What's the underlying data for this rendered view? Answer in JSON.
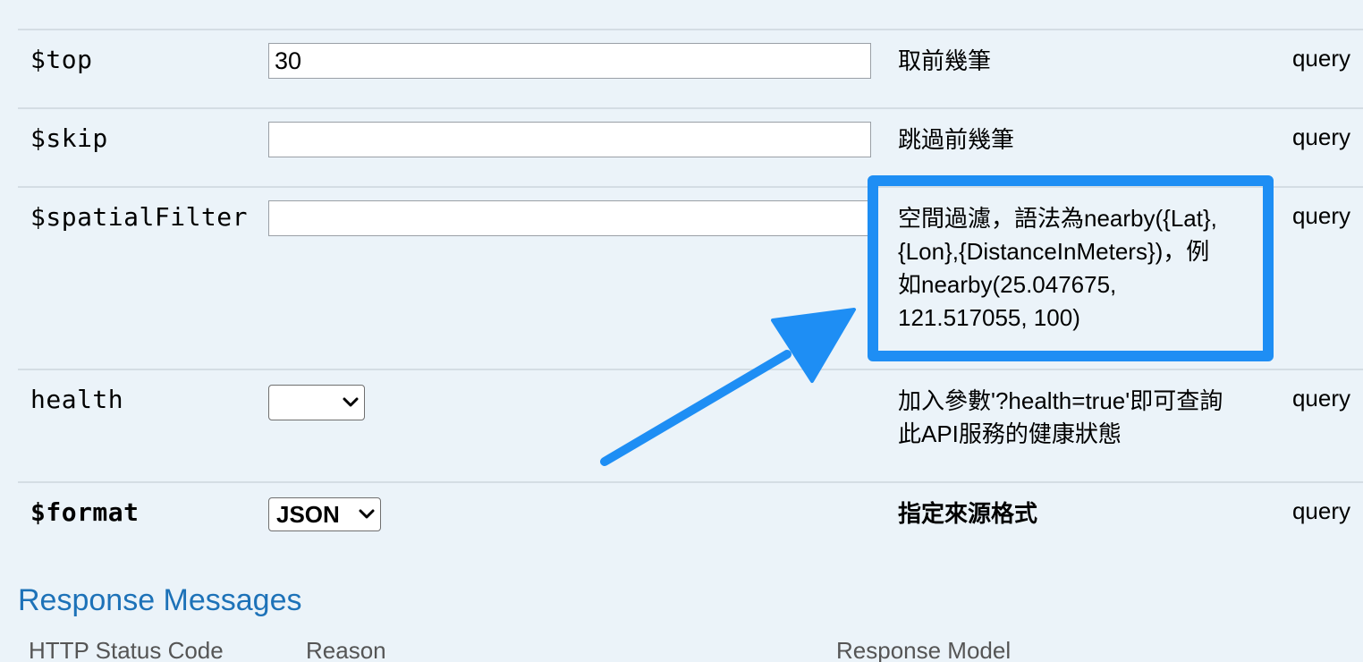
{
  "params": [
    {
      "name": "$top",
      "value": "30",
      "description": "取前幾筆",
      "location": "query"
    },
    {
      "name": "$skip",
      "value": "",
      "description": "跳過前幾筆",
      "location": "query"
    },
    {
      "name": "$spatialFilter",
      "value": "",
      "description": "空間過濾，語法為nearby({Lat},{Lon},{DistanceInMeters})，例如nearby(25.047675, 121.517055, 100)",
      "description_lines": [
        "空間過濾，語法為nearby({Lat},",
        "{Lon},{DistanceInMeters})，例",
        "如nearby(25.047675,",
        "121.517055, 100)"
      ],
      "location": "query"
    },
    {
      "name": "health",
      "selected": "",
      "description_lines": [
        "加入參數'?health=true'即可查詢",
        "此API服務的健康狀態"
      ],
      "location": "query"
    },
    {
      "name": "$format",
      "selected": "JSON",
      "description": "指定來源格式",
      "location": "query"
    }
  ],
  "response_messages": {
    "title": "Response Messages",
    "headers": [
      "HTTP Status Code",
      "Reason",
      "Response Model"
    ]
  },
  "annotation": {
    "color": "#1e8ef4"
  },
  "icons": {
    "select_arrow": "chevron-down-icon"
  }
}
